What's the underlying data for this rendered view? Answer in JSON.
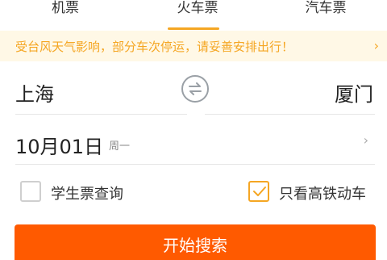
{
  "tabs": [
    {
      "label": "机票"
    },
    {
      "label": "火车票",
      "selected": true
    },
    {
      "label": "汽车票"
    }
  ],
  "notice": {
    "text": "受台风天气影响，部分车次停运，请妥善安排出行！",
    "arrow": "›"
  },
  "route": {
    "from": "上海",
    "to": "厦门",
    "swap_icon": "swap-icon"
  },
  "date": {
    "text": "10月01日",
    "weekday": "周一",
    "arrow": "›"
  },
  "options": {
    "student": {
      "label": "学生票查询",
      "checked": false
    },
    "gaotie": {
      "label": "只看高铁动车",
      "checked": true
    }
  },
  "search_button": {
    "label": "开始搜索"
  },
  "colors": {
    "accent": "#f5a623",
    "notice_bg": "#fff8e6",
    "button": "#ff5a00"
  }
}
